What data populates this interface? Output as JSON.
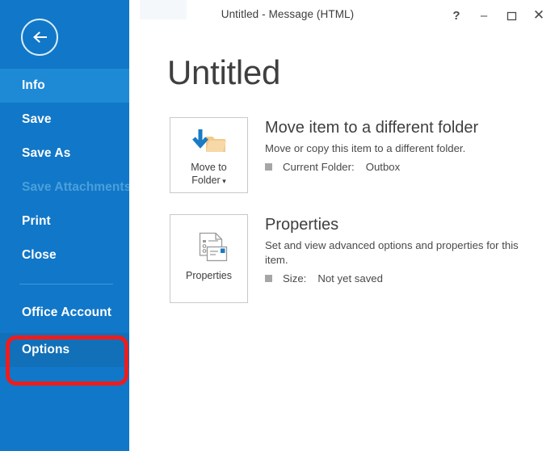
{
  "window": {
    "title": "Untitled - Message (HTML)",
    "controls": [
      {
        "name": "help",
        "glyph": "?"
      },
      {
        "name": "minimize",
        "glyph": "–"
      },
      {
        "name": "maximize",
        "glyph": "□"
      },
      {
        "name": "close",
        "glyph": "✕"
      }
    ]
  },
  "sidebar": {
    "background_color": "#1177c8",
    "back_button_label": "Back",
    "items": [
      {
        "label": "Info",
        "state": "selected"
      },
      {
        "label": "Save",
        "state": "normal"
      },
      {
        "label": "Save As",
        "state": "normal"
      },
      {
        "label": "Save Attachments",
        "state": "disabled"
      },
      {
        "label": "Print",
        "state": "normal"
      },
      {
        "label": "Close",
        "state": "normal"
      },
      {
        "label": "Office Account",
        "state": "normal"
      },
      {
        "label": "Options",
        "state": "highlighted"
      }
    ]
  },
  "annotation": {
    "target": "Options",
    "color": "#ee1c1c"
  },
  "main": {
    "page_title": "Untitled",
    "rows": [
      {
        "button_label_line1": "Move to",
        "button_label_line2": "Folder",
        "button_has_dropdown": true,
        "icon": "move-to-folder-icon",
        "heading": "Move item to a different folder",
        "description": "Move or copy this item to a different folder.",
        "fact_label": "Current Folder:",
        "fact_value": "Outbox"
      },
      {
        "button_label_line1": "Properties",
        "button_label_line2": "",
        "button_has_dropdown": false,
        "icon": "properties-icon",
        "heading": "Properties",
        "description": "Set and view advanced options and properties for this item.",
        "fact_label": "Size:",
        "fact_value": "Not yet saved"
      }
    ]
  }
}
